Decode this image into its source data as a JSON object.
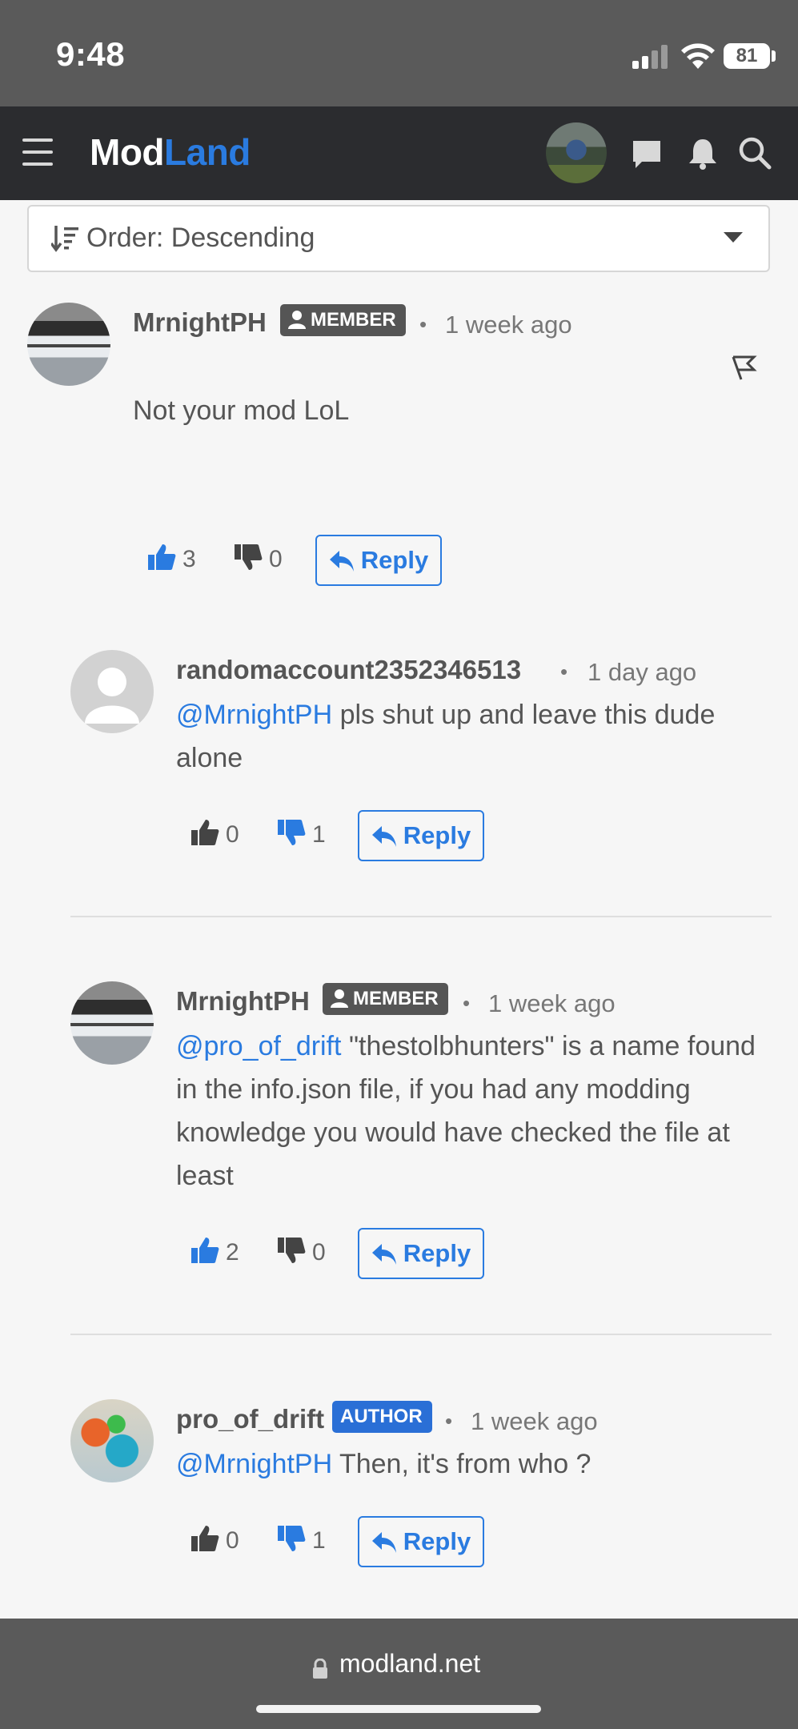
{
  "status_bar": {
    "time": "9:48",
    "battery": "81"
  },
  "header": {
    "logo_part1": "Mod",
    "logo_part2": "Land"
  },
  "sort": {
    "label": "Order: Descending"
  },
  "comments": [
    {
      "username": "MrnightPH",
      "badge": "MEMBER",
      "time": "1 week ago",
      "body": "Not your mod LoL",
      "likes": "3",
      "dislikes": "0",
      "reply_label": "Reply"
    },
    {
      "username": "randomaccount2352346513",
      "time": "1 day ago",
      "mention": "@MrnightPH",
      "body": " pls shut up and leave this dude alone",
      "likes": "0",
      "dislikes": "1",
      "reply_label": "Reply"
    },
    {
      "username": "MrnightPH",
      "badge": "MEMBER",
      "time": "1 week ago",
      "mention": "@pro_of_drift",
      "body": " \"thestolbhunters\" is a name found in the info.json file, if you had any modding knowledge you would have checked the file at least",
      "likes": "2",
      "dislikes": "0",
      "reply_label": "Reply"
    },
    {
      "username": "pro_of_drift",
      "badge": "AUTHOR",
      "time": "1 week ago",
      "mention": "@MrnightPH",
      "body": " Then, it's from who ?",
      "likes": "0",
      "dislikes": "1",
      "reply_label": "Reply"
    }
  ],
  "url_bar": {
    "url": "modland.net"
  },
  "colors": {
    "accent": "#2a7be0",
    "nav_bg": "#2b2c2f",
    "author_badge": "#2a6fd6",
    "member_badge": "#555555"
  },
  "icons": [
    "menu-icon",
    "chat-icon",
    "bell-icon",
    "search-icon",
    "sort-icon",
    "flag-icon",
    "thumbs-up-icon",
    "thumbs-down-icon",
    "reply-icon",
    "lock-icon"
  ]
}
